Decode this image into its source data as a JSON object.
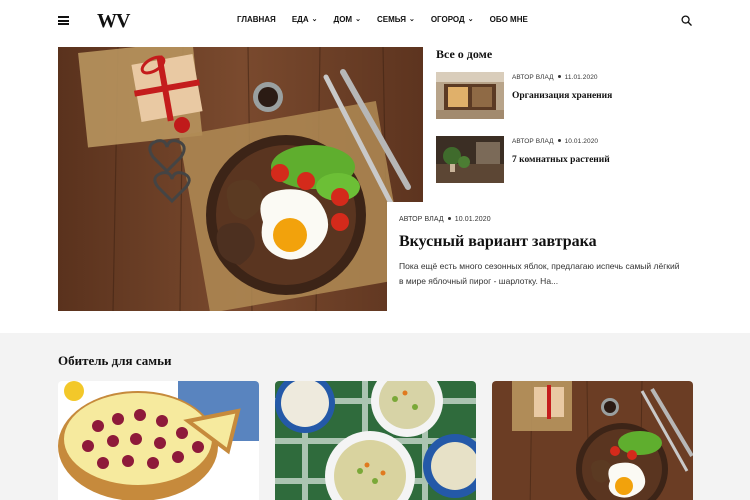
{
  "header": {
    "logo": "WV",
    "menu_icon": "hamburger-menu-icon",
    "search_icon": "search-icon",
    "nav": [
      {
        "label": "ГЛАВНАЯ",
        "dropdown": false
      },
      {
        "label": "ЕДА",
        "dropdown": true
      },
      {
        "label": "ДОМ",
        "dropdown": true
      },
      {
        "label": "СЕМЬЯ",
        "dropdown": true
      },
      {
        "label": "ОГОРОД",
        "dropdown": true
      },
      {
        "label": "ОБО МНЕ",
        "dropdown": false
      }
    ]
  },
  "hero": {
    "author": "АВТОР ВЛАД",
    "date": "10.01.2020",
    "title": "Вкусный вариант завтрака",
    "excerpt": "Пока ещё есть много сезонных яблок, предлагаю испечь самый лёгкий в мире яблочный пирог - шарлотку. На..."
  },
  "sidebar": {
    "title": "Все о доме",
    "items": [
      {
        "author": "АВТОР ВЛАД",
        "date": "11.01.2020",
        "title": "Организация хранения"
      },
      {
        "author": "АВТОР ВЛАД",
        "date": "10.01.2020",
        "title": "7 комнатных растений"
      }
    ]
  },
  "section": {
    "title": "Обитель для самьи"
  },
  "colors": {
    "text": "#111111",
    "section_bg": "#f3f3f3",
    "wood": "#6b3d24"
  }
}
